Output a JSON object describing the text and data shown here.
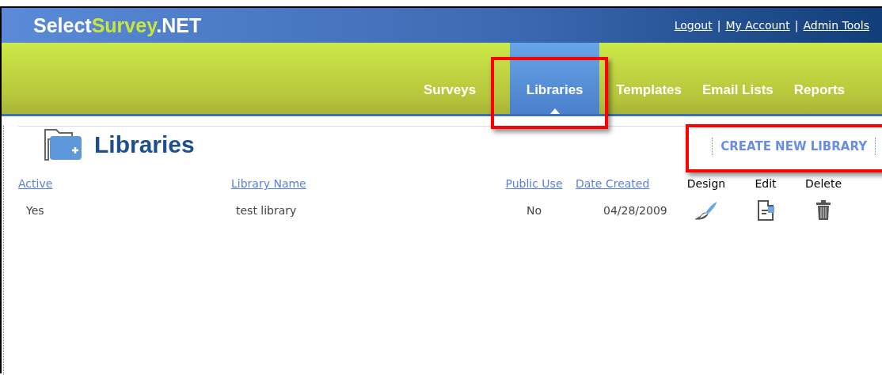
{
  "logo": {
    "parts": [
      {
        "text": "Select",
        "kind": "plain"
      },
      {
        "text": "Survey",
        "kind": "accent"
      },
      {
        "text": ".NET",
        "kind": "plain"
      }
    ]
  },
  "top_links": [
    {
      "text": "Logout",
      "kind": "link"
    },
    {
      "text": "|",
      "kind": "separator"
    },
    {
      "text": "My Account",
      "kind": "link"
    },
    {
      "text": "|",
      "kind": "separator"
    },
    {
      "text": "Admin Tools",
      "kind": "link"
    }
  ],
  "tabs": [
    {
      "label": "Surveys",
      "selected": false
    },
    {
      "label": "Libraries",
      "selected": true
    },
    {
      "label": "Templates",
      "selected": false
    },
    {
      "label": "Email Lists",
      "selected": false
    },
    {
      "label": "Reports",
      "selected": false
    }
  ],
  "page_title": "Libraries",
  "create_button": "CREATE NEW LIBRARY",
  "table": {
    "columns": [
      {
        "label": "Active",
        "kind": "link"
      },
      {
        "label": "Library Name",
        "kind": "link"
      },
      {
        "label": "Public Use",
        "kind": "link"
      },
      {
        "label": "Date Created",
        "kind": "link"
      },
      {
        "label": "Design",
        "kind": "plain"
      },
      {
        "label": "Edit",
        "kind": "plain"
      },
      {
        "label": "Delete",
        "kind": "plain"
      }
    ],
    "rows": [
      {
        "active": "Yes",
        "name": "test library",
        "public_use": "No",
        "date_created": "04/28/2009"
      }
    ]
  }
}
